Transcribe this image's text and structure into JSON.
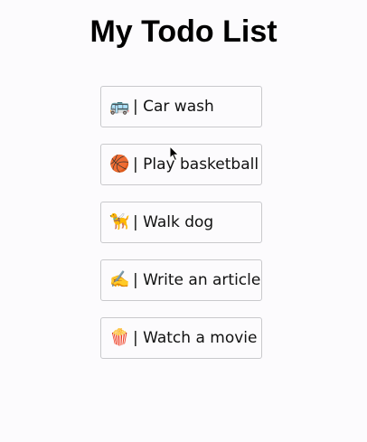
{
  "page": {
    "title": "My Todo List"
  },
  "todos": [
    {
      "icon": "bus-icon",
      "emoji": "🚌",
      "label": "| Car wash"
    },
    {
      "icon": "basketball-icon",
      "emoji": "🏀",
      "label": "| Play basketball"
    },
    {
      "icon": "guide-dog-icon",
      "emoji": "🦮",
      "label": "| Walk dog"
    },
    {
      "icon": "writing-hand-icon",
      "emoji": "✍️",
      "label": "| Write an article"
    },
    {
      "icon": "popcorn-icon",
      "emoji": "🍿",
      "label": "| Watch a movie"
    }
  ]
}
